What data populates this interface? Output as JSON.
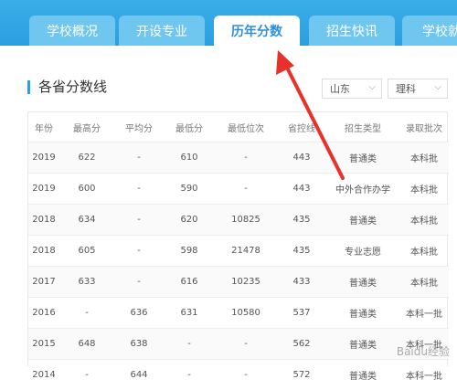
{
  "tabs": [
    {
      "label": "学校概况",
      "active": false
    },
    {
      "label": "开设专业",
      "active": false
    },
    {
      "label": "历年分数",
      "active": true
    },
    {
      "label": "招生快讯",
      "active": false
    },
    {
      "label": "学校就",
      "active": false
    }
  ],
  "section": {
    "title": "各省分数线"
  },
  "filters": {
    "province": "山东",
    "category": "理科"
  },
  "table": {
    "headers": [
      "年份",
      "最高分",
      "平均分",
      "最低分",
      "最低位次",
      "省控线",
      "招生类型",
      "录取批次"
    ],
    "rows": [
      [
        "2019",
        "622",
        "-",
        "610",
        "-",
        "443",
        "普通类",
        "本科批"
      ],
      [
        "2019",
        "600",
        "-",
        "590",
        "-",
        "443",
        "中外合作办学",
        "本科批"
      ],
      [
        "2018",
        "634",
        "-",
        "620",
        "10825",
        "435",
        "普通类",
        "本科批"
      ],
      [
        "2018",
        "605",
        "-",
        "598",
        "21478",
        "435",
        "专业志愿",
        "本科批"
      ],
      [
        "2017",
        "633",
        "-",
        "616",
        "10235",
        "433",
        "普通类",
        "本科批"
      ],
      [
        "2016",
        "-",
        "636",
        "631",
        "10580",
        "537",
        "普通类",
        "本科一批"
      ],
      [
        "2015",
        "648",
        "638",
        "-",
        "-",
        "562",
        "普通类",
        "本科一批"
      ],
      [
        "2014",
        "-",
        "644",
        "-",
        "-",
        "572",
        "普通类",
        "本科一批"
      ]
    ]
  },
  "watermark": "Baidu经验",
  "colors": {
    "accent": "#2b9ee0",
    "arrow": "#e8312a"
  }
}
